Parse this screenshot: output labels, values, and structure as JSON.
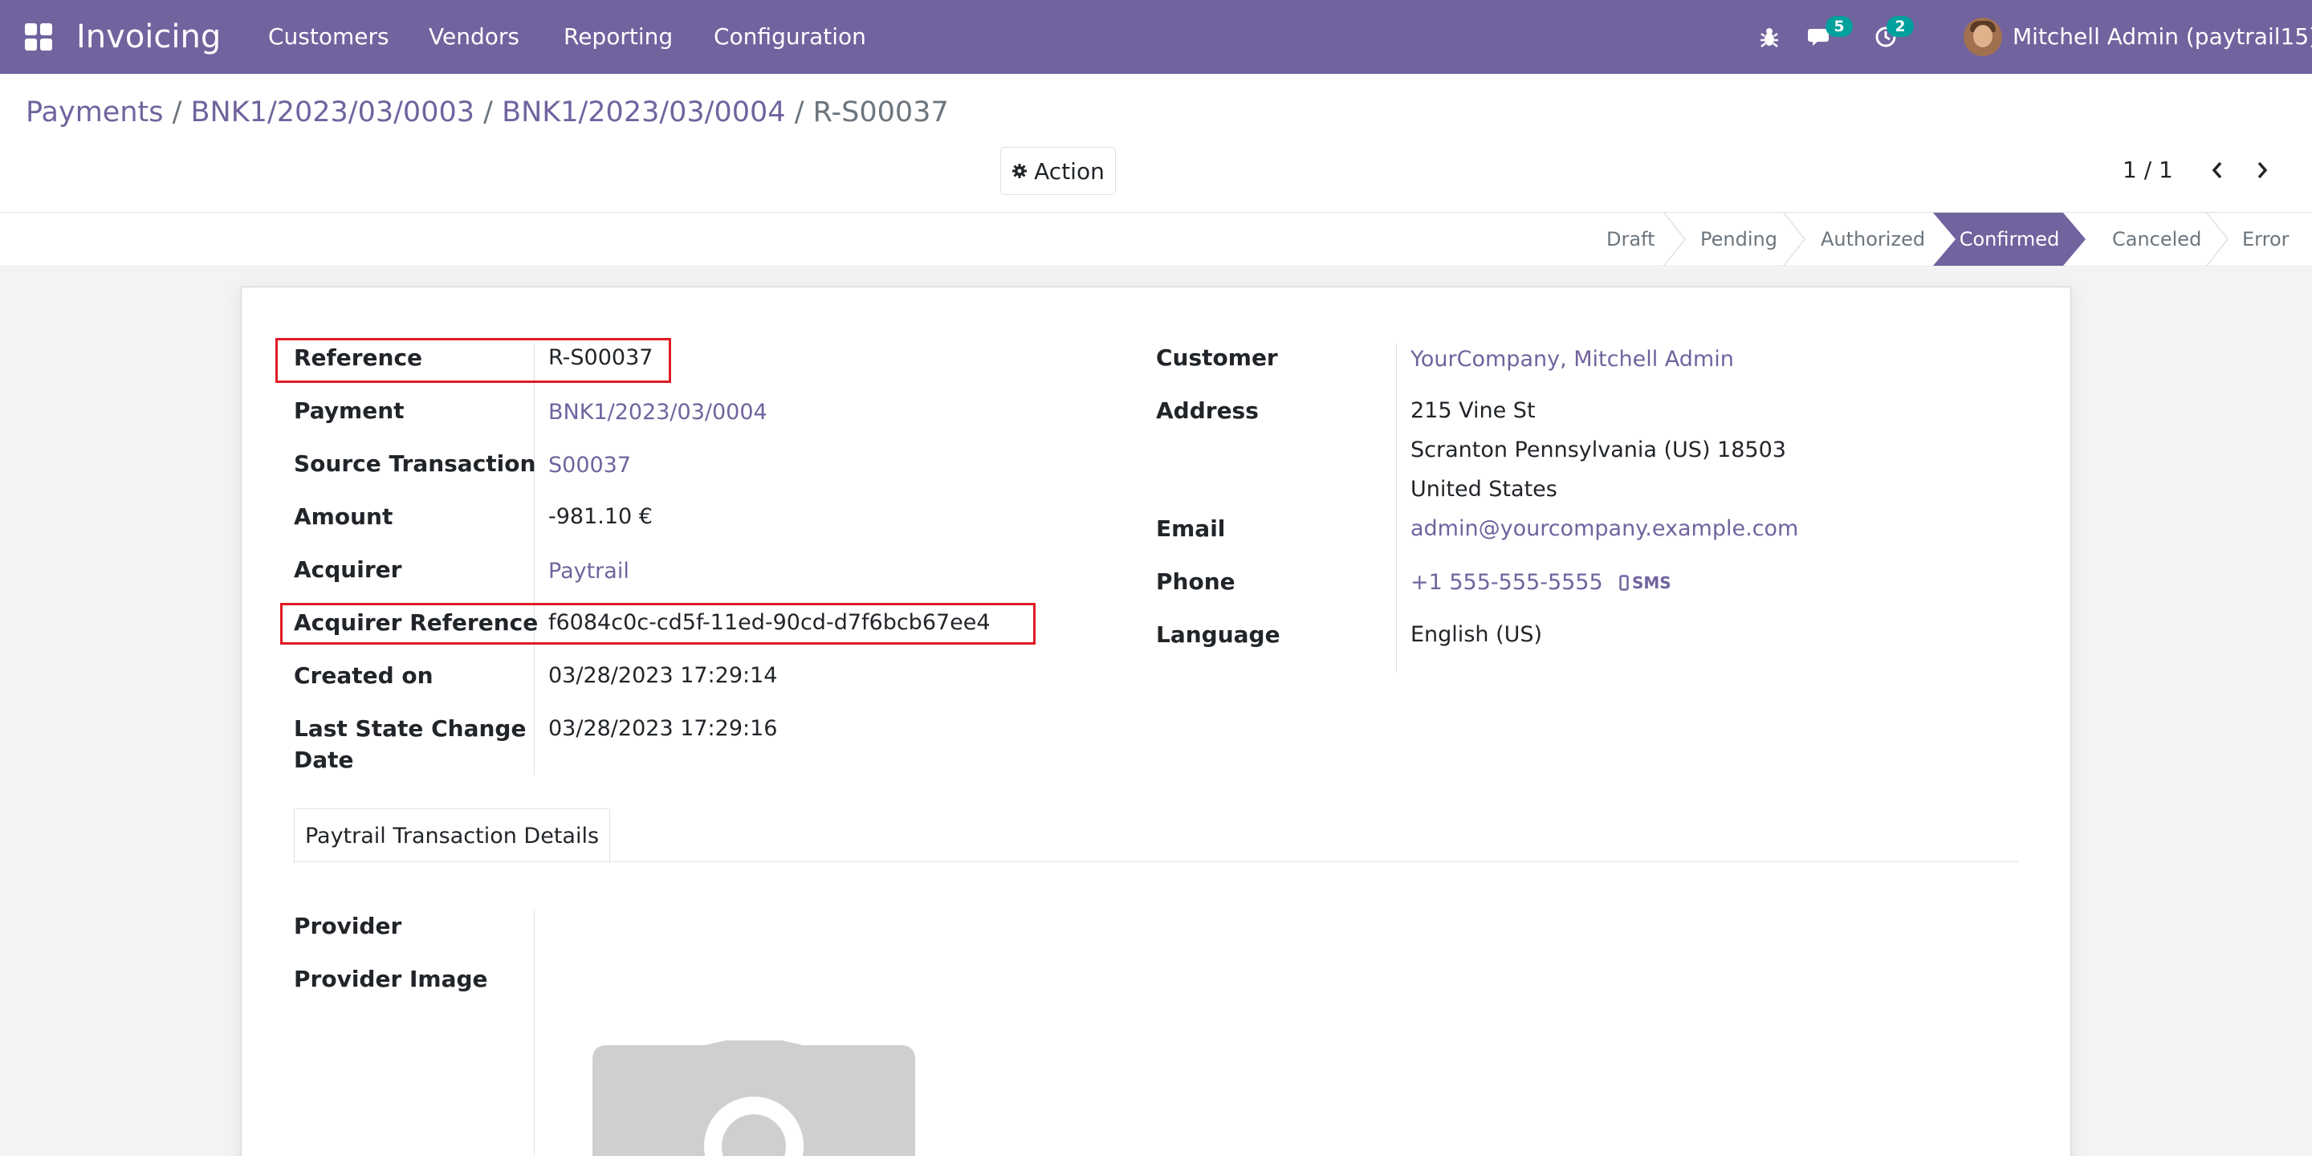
{
  "navbar": {
    "app_name": "Invoicing",
    "menu": [
      "Customers",
      "Vendors",
      "Reporting",
      "Configuration"
    ],
    "messages_count": "5",
    "activities_count": "2",
    "user_name": "Mitchell Admin (paytrail15)",
    "bg_color": "#71639e"
  },
  "breadcrumb": {
    "items": [
      "Payments",
      "BNK1/2023/03/0003",
      "BNK1/2023/03/0004"
    ],
    "current": "R-S00037",
    "separator": "/"
  },
  "toolbar": {
    "action_label": "Action"
  },
  "pager": {
    "value": "1 / 1"
  },
  "statusbar": {
    "stages": [
      "Draft",
      "Pending",
      "Authorized",
      "Confirmed",
      "Canceled",
      "Error"
    ],
    "active": "Confirmed"
  },
  "form": {
    "left": {
      "reference_label": "Reference",
      "reference_value": "R-S00037",
      "payment_label": "Payment",
      "payment_value": "BNK1/2023/03/0004",
      "source_label": "Source Transaction",
      "source_value": "S00037",
      "amount_label": "Amount",
      "amount_value": "-981.10 €",
      "acquirer_label": "Acquirer",
      "acquirer_value": "Paytrail",
      "acq_ref_label": "Acquirer Reference",
      "acq_ref_value": "f6084c0c-cd5f-11ed-90cd-d7f6bcb67ee4",
      "created_label": "Created on",
      "created_value": "03/28/2023 17:29:14",
      "last_change_label_1": "Last State Change",
      "last_change_label_2": "Date",
      "last_change_value": "03/28/2023 17:29:16"
    },
    "right": {
      "customer_label": "Customer",
      "customer_value": "YourCompany, Mitchell Admin",
      "address_label": "Address",
      "address_line1": "215 Vine St",
      "address_line2": "Scranton  Pennsylvania (US)  18503",
      "address_line3": "United States",
      "email_label": "Email",
      "email_value": "admin@yourcompany.example.com",
      "phone_label": "Phone",
      "phone_value": "+1 555-555-5555",
      "sms_label": "SMS",
      "language_label": "Language",
      "language_value": "English (US)"
    },
    "tab_label": "Paytrail Transaction Details",
    "provider_label": "Provider",
    "provider_image_label": "Provider Image"
  }
}
